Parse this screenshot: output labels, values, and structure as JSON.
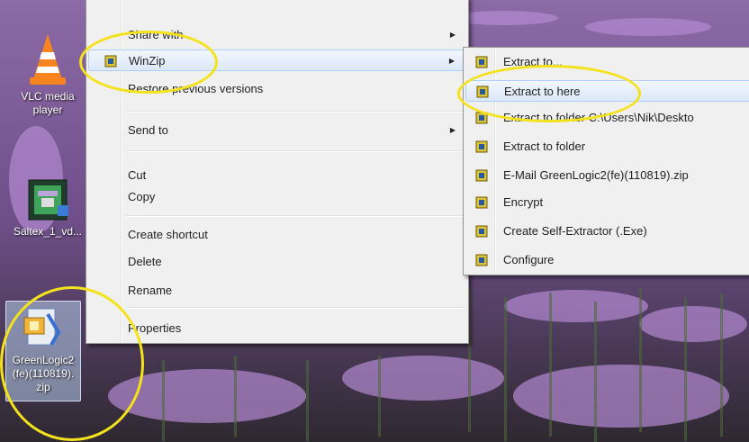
{
  "desktop": {
    "icons": [
      {
        "label": "VLC media player",
        "icon": "vlc-cone-icon"
      },
      {
        "label": "Saltex_1_vd...",
        "icon": "video-file-icon"
      },
      {
        "label": "GreenLogic2(fe)(110819).zip",
        "icon": "winzip-archive-icon"
      }
    ]
  },
  "context_menu": {
    "items": [
      {
        "label": "Share with",
        "submenu": true
      },
      {
        "label": "WinZip",
        "submenu": true,
        "icon": "winzip-icon",
        "highlighted": true
      },
      {
        "label": "Restore previous versions"
      },
      {
        "label": "Send to",
        "submenu": true
      },
      {
        "label": "Cut"
      },
      {
        "label": "Copy"
      },
      {
        "label": "Create shortcut"
      },
      {
        "label": "Delete"
      },
      {
        "label": "Rename"
      },
      {
        "label": "Properties"
      }
    ]
  },
  "winzip_submenu": {
    "items": [
      {
        "label": "Extract to..."
      },
      {
        "label": "Extract to here",
        "highlighted": true
      },
      {
        "label": "Extract to folder C:\\Users\\Nik\\Deskto"
      },
      {
        "label": "Extract to folder"
      },
      {
        "label": "E-Mail GreenLogic2(fe)(110819).zip"
      },
      {
        "label": "Encrypt"
      },
      {
        "label": "Create Self-Extractor (.Exe)"
      },
      {
        "label": "Configure"
      }
    ]
  },
  "colors": {
    "annotation_ring": "#f4e21c",
    "menu_background": "#f0f0f0",
    "hover_background": "#dbe8f8"
  }
}
